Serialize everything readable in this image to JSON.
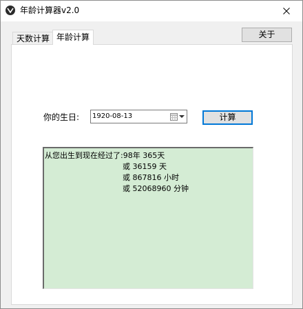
{
  "window": {
    "title": "年龄计算器v2.0"
  },
  "tabs": [
    {
      "label": "天数计算",
      "active": false
    },
    {
      "label": "年龄计算",
      "active": true
    }
  ],
  "toolbar": {
    "about_label": "关于"
  },
  "form": {
    "birth_label": "你的生日:",
    "birth_value": "1920-08-13",
    "calc_label": "计算"
  },
  "result": {
    "lines": [
      "从您出生到现在经过了:98年 365天",
      "或 36159 天",
      "或 867816 小时",
      "或 52068960 分钟"
    ]
  },
  "colors": {
    "result_bg": "#d4ecd4",
    "accent": "#0078d7"
  },
  "icons": {
    "app": "app-logo-icon",
    "close": "close-icon",
    "calendar": "calendar-icon",
    "dropdown": "chevron-down-icon"
  }
}
